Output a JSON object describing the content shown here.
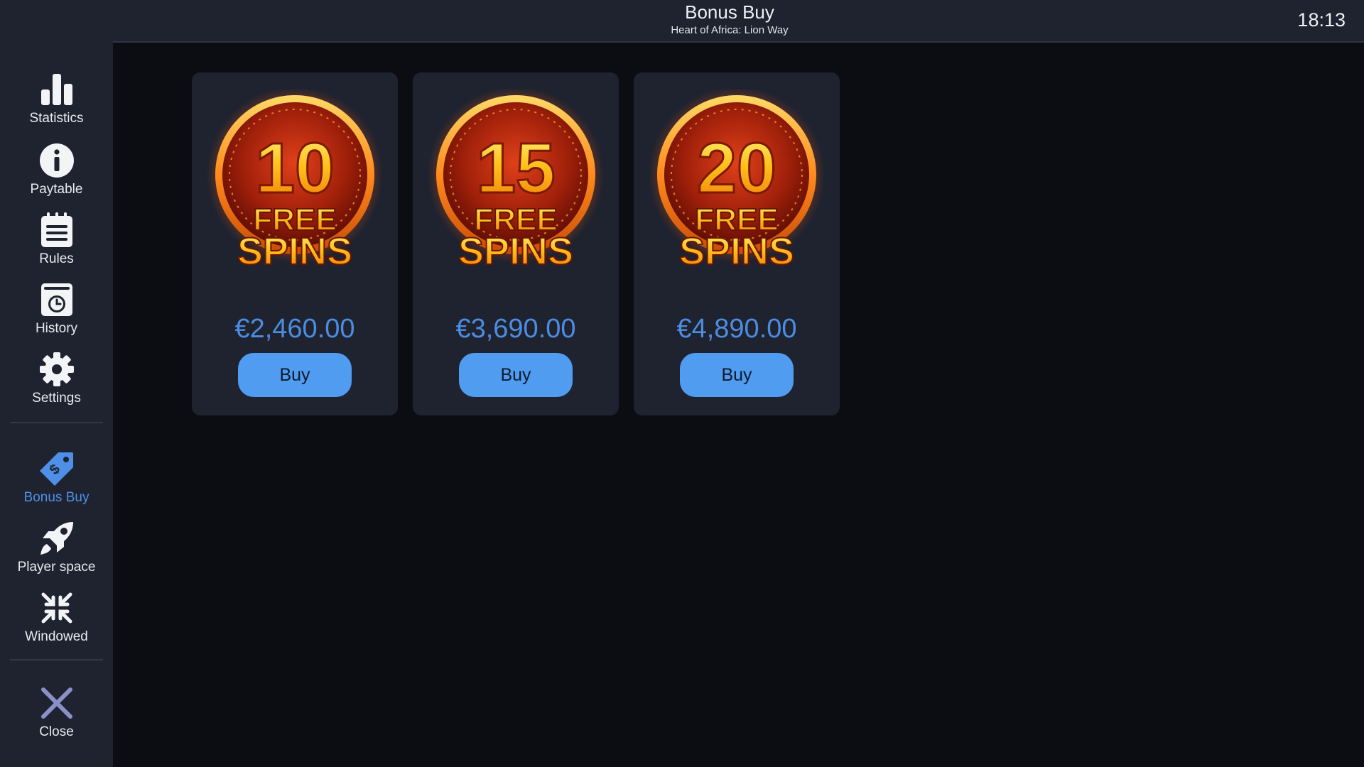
{
  "header": {
    "title": "Bonus Buy",
    "subtitle": "Heart of Africa: Lion Way",
    "clock": "18:13"
  },
  "sidebar": {
    "items": [
      {
        "label": "Statistics",
        "icon": "bar-chart-icon"
      },
      {
        "label": "Paytable",
        "icon": "info-icon"
      },
      {
        "label": "Rules",
        "icon": "notepad-icon"
      },
      {
        "label": "History",
        "icon": "history-clock-icon"
      },
      {
        "label": "Settings",
        "icon": "gear-icon"
      },
      {
        "label": "Bonus Buy",
        "icon": "price-tag-icon",
        "active": true
      },
      {
        "label": "Player space",
        "icon": "rocket-icon"
      },
      {
        "label": "Windowed",
        "icon": "collapse-arrows-icon"
      },
      {
        "label": "Close",
        "icon": "close-icon"
      }
    ]
  },
  "offers": [
    {
      "spins": "10",
      "badge_line1": "FREE",
      "badge_line2": "SPINS",
      "price": "€2,460.00",
      "button": "Buy"
    },
    {
      "spins": "15",
      "badge_line1": "FREE",
      "badge_line2": "SPINS",
      "price": "€3,690.00",
      "button": "Buy"
    },
    {
      "spins": "20",
      "badge_line1": "FREE",
      "badge_line2": "SPINS",
      "price": "€4,890.00",
      "button": "Buy"
    }
  ],
  "colors": {
    "accent": "#4e8fe8",
    "button": "#4f9cf0",
    "panel": "#1f2330",
    "background": "#0b0d12",
    "badge_gold": "#ffb21a",
    "badge_red": "#b52208"
  }
}
